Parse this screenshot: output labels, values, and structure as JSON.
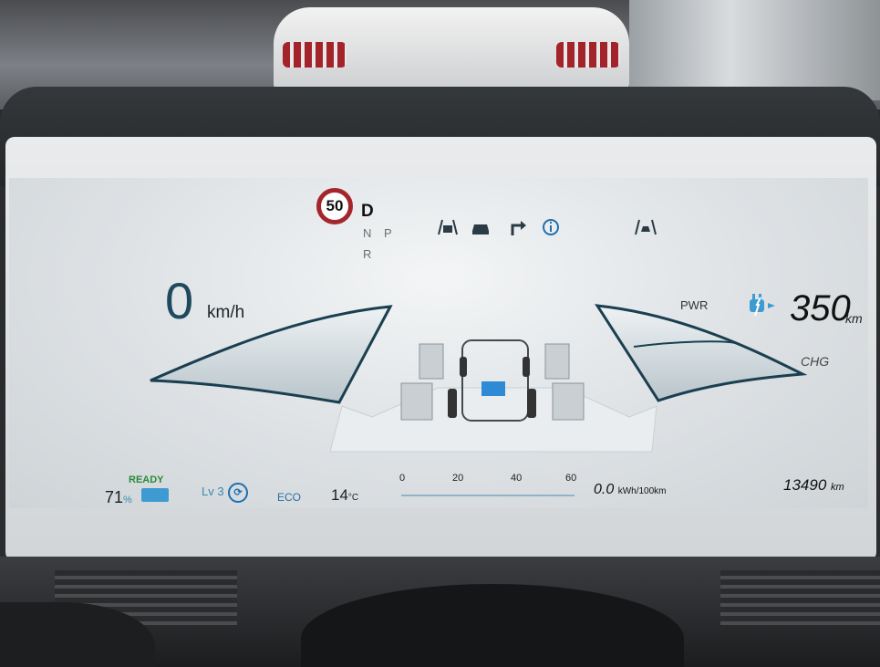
{
  "speed_limit": "50",
  "gears": {
    "active": "D",
    "n": "N",
    "p": "P",
    "r": "R"
  },
  "speed": {
    "value": "0",
    "unit": "km/h"
  },
  "power_labels": {
    "pwr": "PWR",
    "chg": "CHG"
  },
  "range": {
    "value": "350",
    "unit": "km"
  },
  "battery": {
    "status": "READY",
    "percent": "71",
    "percent_unit": "%"
  },
  "regen": {
    "level": "Lv 3"
  },
  "drive_mode": "ECO",
  "outside_temp": {
    "value": "14",
    "unit": "°C"
  },
  "consumption_gauge": {
    "ticks": [
      "0",
      "20",
      "40",
      "60"
    ],
    "level_fraction": 0.0
  },
  "consumption": {
    "value": "0.0",
    "unit": "kWh/100km"
  },
  "odometer": {
    "value": "13490",
    "unit": "km"
  },
  "icons": [
    "lane-keep-icon",
    "car-ahead-icon",
    "turn-right-arrow-icon",
    "info-icon",
    "forward-collision-icon",
    "charging-plug-icon",
    "battery-icon",
    "regen-icon"
  ],
  "colors": {
    "accent_blue": "#3e9bd2",
    "speed_limit_red": "#a3262c",
    "ready_green": "#2a8a3a"
  }
}
